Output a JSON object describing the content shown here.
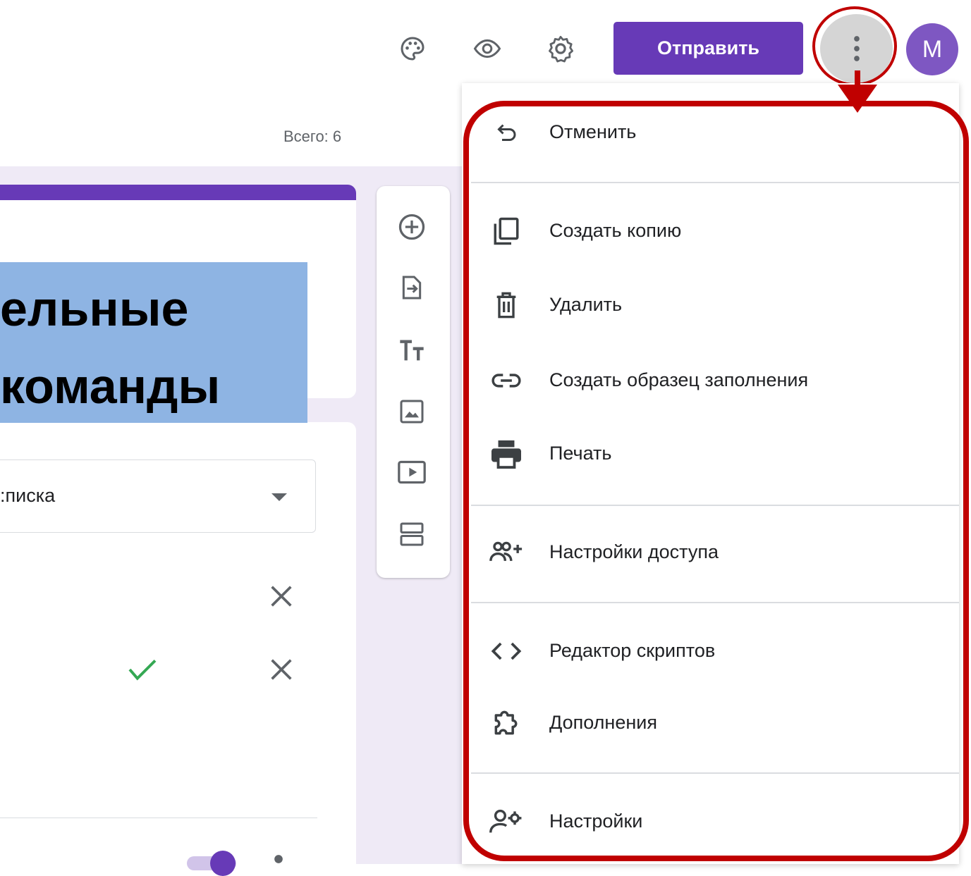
{
  "header": {
    "send_label": "Отправить",
    "avatar_letter": "M",
    "icons": [
      "palette-icon",
      "eye-icon",
      "gear-icon",
      "more-vert-icon"
    ]
  },
  "summary": {
    "total_label": "Всего: 6"
  },
  "overlay": {
    "line1": "ельные",
    "line2": " команды"
  },
  "question": {
    "dropdown_partial_text": ":писка"
  },
  "toolbar": {
    "icons": [
      "add-question-icon",
      "import-questions-icon",
      "title-text-icon",
      "image-icon",
      "video-icon",
      "section-icon"
    ]
  },
  "menu": {
    "items": [
      {
        "label": "Отменить",
        "icon": "undo-icon"
      },
      {
        "label": "Создать копию",
        "icon": "copy-icon"
      },
      {
        "label": "Удалить",
        "icon": "trash-icon"
      },
      {
        "label": "Создать образец заполнения",
        "icon": "link-icon"
      },
      {
        "label": "Печать",
        "icon": "print-icon"
      },
      {
        "label": "Настройки доступа",
        "icon": "people-add-icon"
      },
      {
        "label": "Редактор скриптов",
        "icon": "code-icon"
      },
      {
        "label": "Дополнения",
        "icon": "puzzle-icon"
      },
      {
        "label": "Настройки",
        "icon": "person-settings-icon"
      }
    ]
  },
  "colors": {
    "accent": "#673ab7",
    "annotation_red": "#c00000",
    "overlay_blue": "#8eb4e3",
    "form_background": "#efeaf6"
  }
}
